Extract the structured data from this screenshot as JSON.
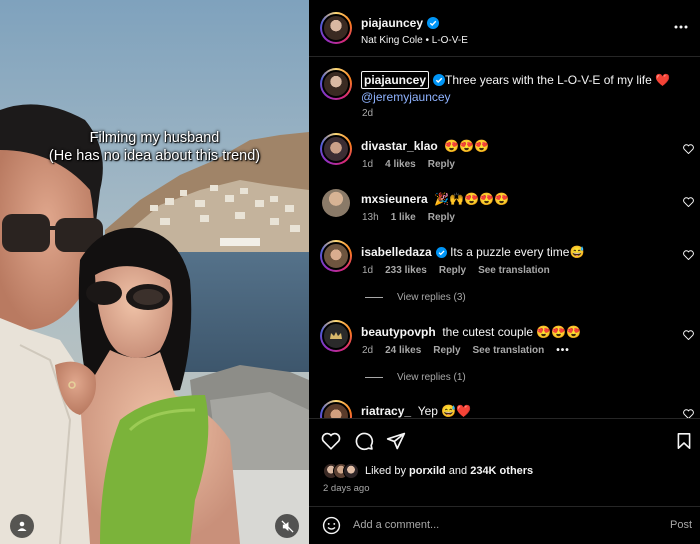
{
  "media": {
    "overlay_line1": "Filming my husband",
    "overlay_line2": "(He has no idea about this trend)"
  },
  "header": {
    "username": "piajauncey",
    "song": "Nat King Cole • L-O-V-E"
  },
  "caption": {
    "username": "piajauncey",
    "text": "Three years with the L-O-V-E of my life ❤️",
    "mention": "@jeremyjauncey",
    "time": "2d"
  },
  "comments": [
    {
      "username": "divastar_klao",
      "text": "😍😍😍",
      "time": "1d",
      "likes": "4 likes",
      "reply": "Reply"
    },
    {
      "username": "mxsieunera",
      "text": "🎉🙌😍😍😍",
      "time": "13h",
      "likes": "1 like",
      "reply": "Reply"
    },
    {
      "username": "isabelledaza",
      "text": "Its a puzzle every time😅",
      "time": "1d",
      "likes": "233 likes",
      "reply": "Reply",
      "translation": "See translation",
      "view_replies": "View replies (3)"
    },
    {
      "username": "beautypovph",
      "text": "the cutest couple 😍😍😍",
      "time": "2d",
      "likes": "24 likes",
      "reply": "Reply",
      "translation": "See translation",
      "more": "•••",
      "view_replies": "View replies (1)"
    },
    {
      "username": "riatracy_",
      "text": "Yep 😅❤️"
    }
  ],
  "likes": {
    "prefix": "Liked by",
    "user": "porxild",
    "and": "and",
    "count": "234K others"
  },
  "post_age": "2 days ago",
  "comment_box": {
    "placeholder": "Add a comment...",
    "post": "Post"
  },
  "colors": {
    "verified": "#0095f6",
    "like_heart": "#ff3040"
  }
}
